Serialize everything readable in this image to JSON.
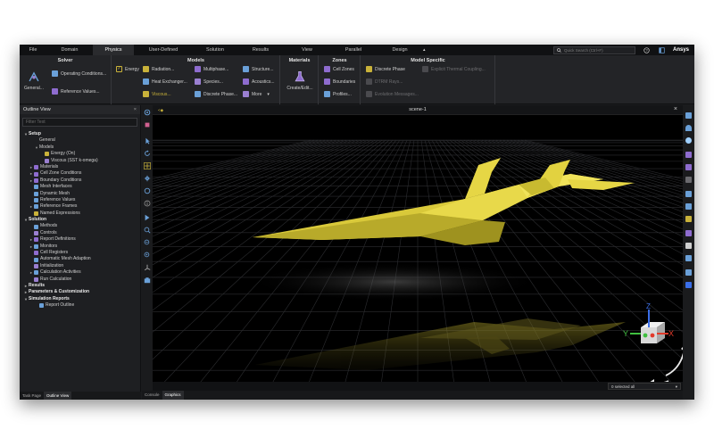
{
  "menubar": {
    "tabs": [
      {
        "label": "File",
        "active": false,
        "w": 30
      },
      {
        "label": "Domain",
        "active": false,
        "w": 52
      },
      {
        "label": "Physics",
        "active": true,
        "w": 46
      },
      {
        "label": "User-Defined",
        "active": false,
        "w": 66
      },
      {
        "label": "Solution",
        "active": false,
        "w": 50
      },
      {
        "label": "Results",
        "active": false,
        "w": 52
      },
      {
        "label": "View",
        "active": false,
        "w": 52
      },
      {
        "label": "Parallel",
        "active": false,
        "w": 52
      },
      {
        "label": "Design",
        "active": false,
        "w": 52
      }
    ],
    "search_placeholder": "Quick Search (Ctrl+F)",
    "brand": "Ansys"
  },
  "ribbon": {
    "solver": {
      "title": "Solver",
      "general": "General...",
      "operating_conditions": "Operating Conditions...",
      "reference_values": "Reference Values..."
    },
    "models": {
      "title": "Models",
      "energy": "Energy",
      "radiation": "Radiation...",
      "heat_exchanger": "Heat Exchanger...",
      "viscous": "Viscous...",
      "multiphase": "Multiphase...",
      "species": "Species...",
      "discrete_phase": "Discrete Phase...",
      "structure": "Structure...",
      "acoustics": "Acoustics...",
      "more": "More"
    },
    "materials": {
      "title": "Materials",
      "create_edit": "Create/Edit..."
    },
    "zones": {
      "title": "Zones",
      "cell_zones": "Cell Zones",
      "boundaries": "Boundaries",
      "profiles": "Profiles..."
    },
    "model_specific": {
      "title": "Model Specific",
      "discrete_phase": "Discrete Phase",
      "drm_rays": "DTRM Rays...",
      "evolution_messages": "Evolution Messages...",
      "explicit_thermal": "Explicit Thermal Coupling..."
    }
  },
  "outline": {
    "title": "Outline View",
    "filter_placeholder": "Filter Text",
    "tree": [
      {
        "label": "Setup",
        "depth": 0,
        "exp": "-",
        "bold": true,
        "icon": ""
      },
      {
        "label": "General",
        "depth": 2,
        "exp": "",
        "bold": false,
        "icon": ""
      },
      {
        "label": "Models",
        "depth": 2,
        "exp": "-",
        "bold": false,
        "icon": ""
      },
      {
        "label": "Energy (On)",
        "depth": 3,
        "exp": "",
        "bold": false,
        "icon": "#c9b23a"
      },
      {
        "label": "Viscous (SST k-omega)",
        "depth": 3,
        "exp": "",
        "bold": false,
        "icon": "#9a7fd1"
      },
      {
        "label": "Materials",
        "depth": 1,
        "exp": "+",
        "bold": false,
        "icon": "#8e6ccf"
      },
      {
        "label": "Cell Zone Conditions",
        "depth": 1,
        "exp": "+",
        "bold": false,
        "icon": "#8e6ccf"
      },
      {
        "label": "Boundary Conditions",
        "depth": 1,
        "exp": "+",
        "bold": false,
        "icon": "#8e6ccf"
      },
      {
        "label": "Mesh Interfaces",
        "depth": 1,
        "exp": "",
        "bold": false,
        "icon": "#6aa0d8"
      },
      {
        "label": "Dynamic Mesh",
        "depth": 1,
        "exp": "",
        "bold": false,
        "icon": "#6aa0d8"
      },
      {
        "label": "Reference Values",
        "depth": 1,
        "exp": "",
        "bold": false,
        "icon": "#6aa0d8"
      },
      {
        "label": "Reference Frames",
        "depth": 1,
        "exp": "+",
        "bold": false,
        "icon": "#6aa0d8"
      },
      {
        "label": "Named Expressions",
        "depth": 1,
        "exp": "",
        "bold": false,
        "icon": "#c9b23a"
      },
      {
        "label": "Solution",
        "depth": 0,
        "exp": "-",
        "bold": true,
        "icon": ""
      },
      {
        "label": "Methods",
        "depth": 1,
        "exp": "",
        "bold": false,
        "icon": "#6aa0d8"
      },
      {
        "label": "Controls",
        "depth": 1,
        "exp": "",
        "bold": false,
        "icon": "#9a7fd1"
      },
      {
        "label": "Report Definitions",
        "depth": 1,
        "exp": "+",
        "bold": false,
        "icon": "#8e6ccf"
      },
      {
        "label": "Monitors",
        "depth": 1,
        "exp": "+",
        "bold": false,
        "icon": "#6aa0d8"
      },
      {
        "label": "Cell Registers",
        "depth": 1,
        "exp": "",
        "bold": false,
        "icon": "#8e6ccf"
      },
      {
        "label": "Automatic Mesh Adaption",
        "depth": 1,
        "exp": "",
        "bold": false,
        "icon": "#6aa0d8"
      },
      {
        "label": "Initialization",
        "depth": 1,
        "exp": "",
        "bold": false,
        "icon": "#9a7fd1"
      },
      {
        "label": "Calculation Activities",
        "depth": 1,
        "exp": "+",
        "bold": false,
        "icon": "#6aa0d8"
      },
      {
        "label": "Run Calculation",
        "depth": 1,
        "exp": "",
        "bold": false,
        "icon": "#9a7fd1"
      },
      {
        "label": "Results",
        "depth": 0,
        "exp": "+",
        "bold": true,
        "icon": ""
      },
      {
        "label": "Parameters & Customization",
        "depth": 0,
        "exp": "+",
        "bold": true,
        "icon": ""
      },
      {
        "label": "Simulation Reports",
        "depth": 0,
        "exp": "-",
        "bold": true,
        "icon": ""
      },
      {
        "label": "Report Outline",
        "depth": 2,
        "exp": "",
        "bold": false,
        "icon": "#6aa0d8"
      }
    ],
    "bottom_tabs": [
      {
        "label": "Task Page",
        "active": false
      },
      {
        "label": "Outline View",
        "active": true
      }
    ]
  },
  "viewport": {
    "title": "scene-1",
    "selected": "0 selected all",
    "bottom_tabs": [
      {
        "label": "Console",
        "active": false
      },
      {
        "label": "Graphics",
        "active": true
      }
    ],
    "axes": {
      "x": "X",
      "y": "Y",
      "z": "Z"
    },
    "colors": {
      "model": "#e5d43e",
      "x_axis": "#e23b2b",
      "y_axis": "#3fbf3f",
      "z_axis": "#3a6ee8"
    }
  }
}
